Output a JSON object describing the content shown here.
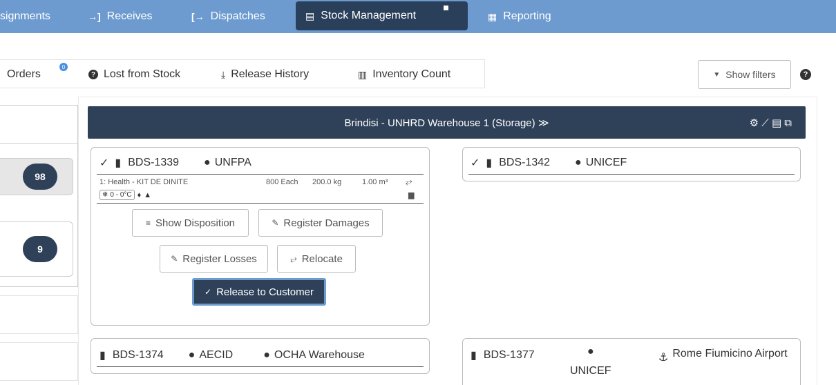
{
  "topnav": {
    "items": [
      {
        "label": "signments",
        "icon": ""
      },
      {
        "label": "Receives",
        "icon": "→]"
      },
      {
        "label": "Dispatches",
        "icon": "[→"
      },
      {
        "label": "Stock Management",
        "icon": "▤"
      },
      {
        "label": "Reporting",
        "icon": "▦"
      }
    ]
  },
  "subnav": {
    "items": [
      {
        "label": "Orders",
        "badge": "0"
      },
      {
        "label": "Lost from Stock",
        "icon": "?"
      },
      {
        "label": "Release History",
        "icon": "⤓"
      },
      {
        "label": "Inventory Count",
        "icon": "▥"
      }
    ],
    "show_filters": "Show filters",
    "help": "?"
  },
  "left": {
    "counts": [
      "98",
      "9"
    ]
  },
  "warehouse": {
    "title": "Brindisi - UNHRD Warehouse 1 (Storage) ≫",
    "tools": "⚙ ⟋ ▤ ⧉"
  },
  "cards": {
    "c1339": {
      "id": "BDS-1339",
      "org": "UNFPA",
      "item_desc": "1: Health - KIT DE DINITE",
      "qty": "800 Each",
      "weight": "200.0 kg",
      "volume": "1.00 m³",
      "temp": "0 - 0°C"
    },
    "c1342": {
      "id": "BDS-1342",
      "org": "UNICEF"
    },
    "c1374": {
      "id": "BDS-1374",
      "org": "AECID",
      "location": "OCHA Warehouse"
    },
    "c1377": {
      "id": "BDS-1377",
      "org": "UNICEF",
      "location": "Rome Fiumicino Airport"
    }
  },
  "actions": {
    "show_disposition": "Show Disposition",
    "register_damages": "Register Damages",
    "register_losses": "Register Losses",
    "relocate": "Relocate",
    "release_to_customer": "Release to Customer"
  },
  "colors": {
    "nav_bg": "#6d9bcf",
    "dark": "#2f4159"
  }
}
